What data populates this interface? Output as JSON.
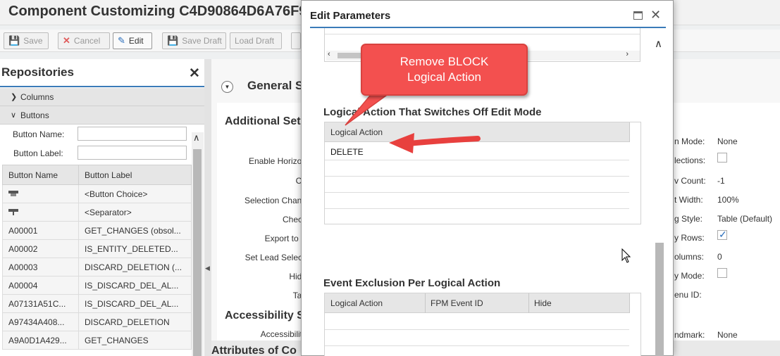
{
  "app": {
    "title": "Component Customizing C4D90864D6A76F9"
  },
  "toolbar": {
    "save": "Save",
    "cancel": "Cancel",
    "edit": "Edit",
    "save_draft": "Save Draft",
    "load_draft": "Load Draft"
  },
  "repositories": {
    "title": "Repositories",
    "sections": {
      "columns": "Columns",
      "buttons": "Buttons"
    },
    "fields": {
      "button_name": "Button Name:",
      "button_label": "Button Label:"
    },
    "table": {
      "headers": [
        "Button Name",
        "Button Label"
      ],
      "rows": [
        {
          "name": "",
          "label": "<Button Choice>",
          "icon": "button-choice-icon"
        },
        {
          "name": "",
          "label": "<Separator>",
          "icon": "separator-icon"
        },
        {
          "name": "A00001",
          "label": "GET_CHANGES (obsol..."
        },
        {
          "name": "A00002",
          "label": "IS_ENTITY_DELETED..."
        },
        {
          "name": "A00003",
          "label": "DISCARD_DELETION (..."
        },
        {
          "name": "A00004",
          "label": "IS_DISCARD_DEL_AL..."
        },
        {
          "name": "A07131A51C...",
          "label": "IS_DISCARD_DEL_AL..."
        },
        {
          "name": "A97434A408...",
          "label": "DISCARD_DELETION"
        },
        {
          "name": "A9A0D1A429...",
          "label": "GET_CHANGES"
        }
      ]
    }
  },
  "main": {
    "general_title": "General S",
    "additional_title": "Additional Set",
    "accessibility_title": "Accessibility S",
    "attributes_title": "Attributes of Co",
    "left_labels": [
      "Enable Horizon",
      "Co",
      "Selection Chang",
      "Check",
      "Export to S",
      "Set Lead Selecti",
      "Hide",
      "Tab",
      "Accessibility"
    ],
    "right_labels": [
      "n Mode:",
      "lections:",
      "v Count:",
      "t Width:",
      "g Style:",
      "y Rows:",
      "olumns:",
      "y Mode:",
      "enu ID:",
      "ndmark:"
    ],
    "right_values": {
      "mode": "None",
      "row_count": "-1",
      "width": "100%",
      "style": "Table (Default)",
      "columns": "0",
      "landmark": "None"
    }
  },
  "modal": {
    "title": "Edit Parameters",
    "section1_title": "Logical Action That Switches Off Edit Mode",
    "grid1": {
      "header": "Logical Action",
      "rows": [
        "DELETE"
      ]
    },
    "section2_title": "Event Exclusion Per Logical Action",
    "grid2": {
      "headers": [
        "Logical Action",
        "FPM Event ID",
        "Hide"
      ]
    }
  },
  "callout": {
    "line1": "Remove BLOCK",
    "line2": "Logical Action"
  },
  "colors": {
    "accent": "#3a7bb8",
    "callout": "#f3504f",
    "arrow": "#e8403e"
  }
}
